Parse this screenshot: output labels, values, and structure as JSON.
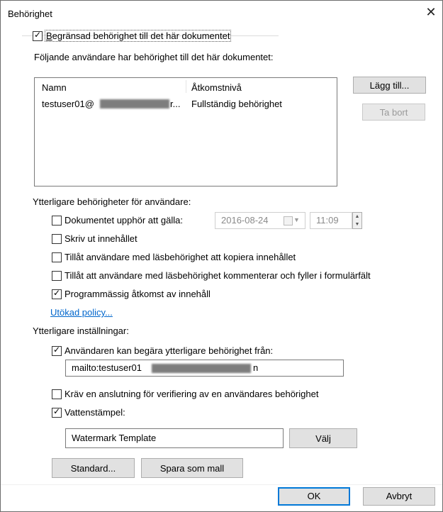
{
  "dialog": {
    "title": "Behörighet",
    "close_label": "✕"
  },
  "restrict": {
    "checked": true,
    "label_pre": "",
    "label_ul": "B",
    "label_post": "egränsad behörighet till det här dokumentet"
  },
  "users": {
    "heading": "Följande användare har behörighet till det här dokumentet:",
    "columns": [
      "Namn",
      "Åtkomstnivå"
    ],
    "rows": [
      {
        "name": "testuser01@",
        "name_tail": "r...",
        "access": "Fullständig behörighet"
      }
    ],
    "add_button": "Lägg till...",
    "remove_button": "Ta bort"
  },
  "additional_permissions": {
    "heading": "Ytterligare behörigheter för användare:",
    "expire_label": "Dokumentet upphör att gälla:",
    "expire_date": "2016-08-24",
    "expire_time": "11:09",
    "print_label": "Skriv ut innehållet",
    "copy_label": "Tillåt användare med läsbehörighet att kopiera innehållet",
    "comment_label": "Tillåt att användare med läsbehörighet kommenterar och fyller i formulärfält",
    "programmatic_label": "Programmässig åtkomst av innehåll",
    "extended_policy_link": "Utökad policy..."
  },
  "additional_settings": {
    "heading": "Ytterligare inställningar:",
    "request_label": "Användaren kan begära ytterligare behörighet från:",
    "request_value": "mailto:testuser01",
    "request_value_tail": "n",
    "verify_label": "Kräv en anslutning för verifiering av en användares behörighet",
    "watermark_label": "Vattenstämpel:",
    "watermark_value": "Watermark Template",
    "choose_button": "Välj"
  },
  "footer": {
    "default_button": "Standard...",
    "save_template_button": "Spara som mall",
    "ok_button": "OK",
    "cancel_button": "Avbryt"
  },
  "checkbox_states": {
    "expire": false,
    "print": false,
    "copy": false,
    "comment": false,
    "programmatic": true,
    "request": true,
    "verify": false,
    "watermark": true
  },
  "colors": {
    "link": "#0066cc",
    "default_button_border": "#0078d7",
    "button_face": "#e1e1e1"
  }
}
